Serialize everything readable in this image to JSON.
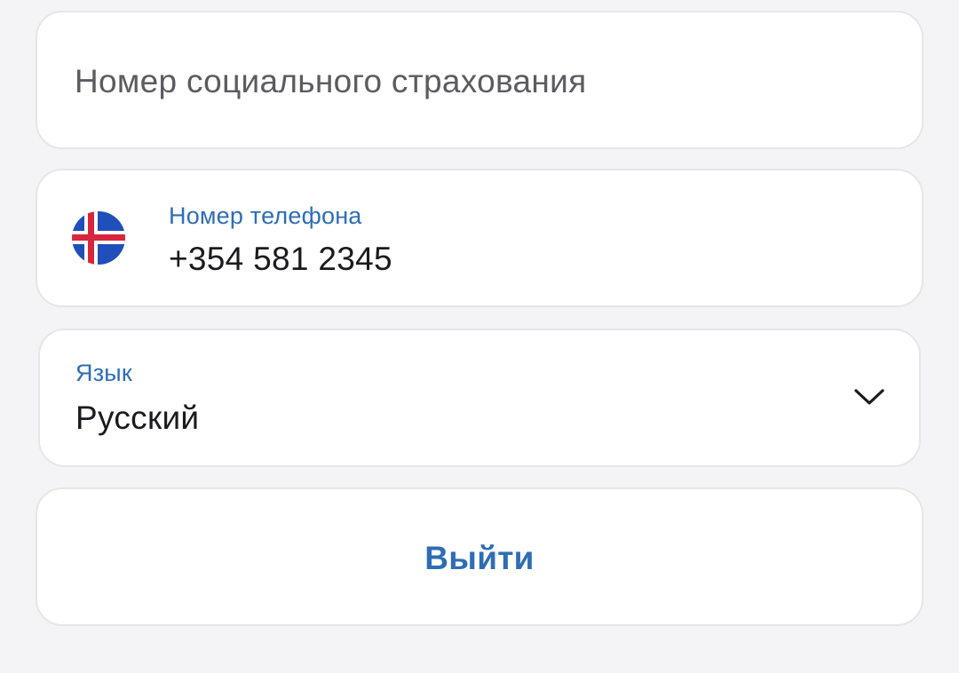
{
  "ssn_field": {
    "placeholder": "Номер социального страхования",
    "value": ""
  },
  "phone_field": {
    "label": "Номер телефона",
    "value": "+354 581 2345",
    "country_flag": "iceland-flag-icon"
  },
  "language_select": {
    "label": "Язык",
    "selected": "Русский",
    "icon": "chevron-down-icon"
  },
  "logout": {
    "label": "Выйти"
  },
  "colors": {
    "background": "#f4f4f6",
    "card": "#ffffff",
    "accent": "#2f6db3",
    "text": "#1b1b1f",
    "placeholder": "#5b5b60"
  }
}
